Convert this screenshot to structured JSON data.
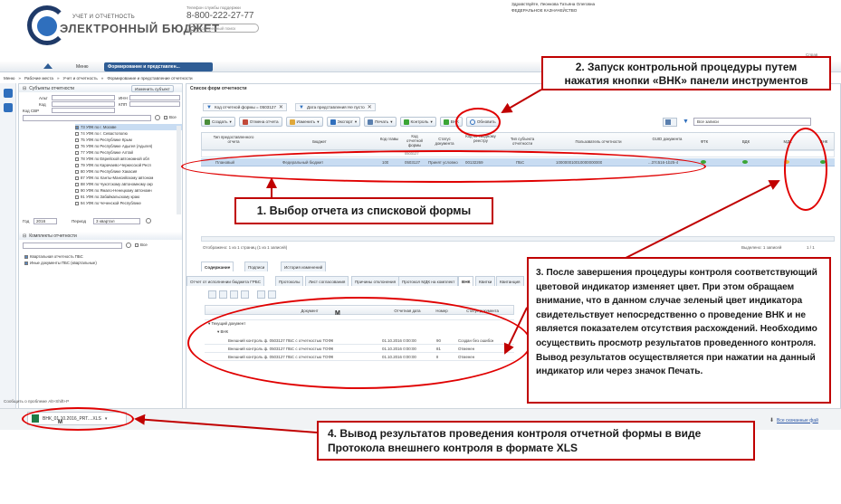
{
  "brand": {
    "line1": "УЧЕТ И ОТЧЕТНОСТЬ",
    "line2": "ЭЛЕКТРОННЫЙ БЮДЖЕТ"
  },
  "support": {
    "caption": "Телефон службы поддержки",
    "phone": "8-800-222-27-77"
  },
  "search": {
    "placeholder": "Расширенный поиск"
  },
  "user": {
    "greeting": "Здравствуйте, Леонкова Татьяна Олеговна",
    "org": "ФЕДЕРАЛЬНОЕ КАЗНАЧЕЙСТВО",
    "right_label": "Справ"
  },
  "nav": {
    "menu": "Меню",
    "active_tab": "Формирование и представлен..."
  },
  "breadcrumb": [
    "Меню",
    "Рабочие места",
    "Учет и отчетность",
    "Формирование и представление отчетности"
  ],
  "left": {
    "subjects_title": "Субъекты отчетности",
    "change_subject": "Изменить субъект",
    "alt_label": "Альт",
    "inn_label": "ИНН",
    "code_label": "Код",
    "kpp_label": "КПП",
    "svr_label": "Код СВР",
    "all_label": "Все",
    "tree": [
      "73 УФК по г. Москве",
      "74 УФК по г. Севастополю",
      "75 УФК по Республике Крым",
      "76 УФК по Республике Адыгея (Адыгея)",
      "77 УФК по Республике Алтай",
      "78 УФК по Еврейской автономной обл",
      "79 УФК по Карачаево-Черкесской Респ",
      "80 УФК по Республике Хакасия",
      "87 УФК по Ханты-Мансийскому автоном",
      "88 УФК по Чукотскому автономному окр",
      "90 УФК по Ямало-Ненецкому автономн",
      "91 УФК по Забайкальскому краю",
      "94 УФК по Чеченской Республике"
    ],
    "year_label": "Год",
    "year": "2016",
    "period_label": "Период",
    "period": "3 квартал",
    "sets_title": "Комплекты отчетности",
    "sets_all": "Все",
    "sets": [
      "Квартальная отчетность ПБС",
      "Иные документы ПБС (квартальные)"
    ]
  },
  "main": {
    "title": "Список форм отчетности",
    "filters": [
      "Код отчетной формы = 0503127",
      "Дата представления Не пусто"
    ],
    "toolbar": [
      "Создать",
      "Отмена отчета",
      "Изменить",
      "Экспорт",
      "Печать",
      "Контроль",
      "ВНК",
      "Обновить"
    ],
    "search_placeholder": "Все записи",
    "columns": [
      "Тип предоставленного отчета",
      "Бюджет",
      "Код главы",
      "Код отчетной формы",
      "Статус документа",
      "Код по сводному реестру",
      "Тип субъекта отчетности",
      "Пользователь отчетности",
      "GUID документа",
      "ФТК",
      "ВДК",
      "МДК",
      "ВНК"
    ],
    "filter_value": "0503127",
    "row": [
      "Плановый",
      "Федеральный бюджет",
      "100",
      "0503127",
      "Принят условно",
      "00132269",
      "ПБС",
      "100000010010000000000",
      "...37c516-1b25-4"
    ],
    "statusbar": "Отображено: 1 из 1 страниц (1 из 1 записей)",
    "selected": "Выделено: 1 записей",
    "page_info": "1 / 1"
  },
  "bottom": {
    "tabs": [
      "Содержание",
      "Подписи",
      "История изменений"
    ],
    "subtabs": [
      "Отчет от исполнении бюджета ГРБС",
      "Протоколы",
      "Лист согласования",
      "Причины отклонения",
      "Протокол МДК на комплект",
      "ВНК",
      "Квитки",
      "Квитанция"
    ],
    "columns": [
      "Документ",
      "Отчетная дата",
      "Номер",
      "Статус документа"
    ],
    "cursor_label": "M",
    "group1": "Текущий документ",
    "group2": "ВНК",
    "rows": [
      [
        "Внешний контроль ф. 0503127 ПБС с отчетностью ТОФК",
        "01.10.2016 0:00:00",
        "90",
        "Создан без ошибок"
      ],
      [
        "Внешний контроль ф. 0503127 ПБС с отчетностью ТОФК",
        "01.10.2016 0:00:00",
        "81",
        "Отменен"
      ],
      [
        "Внешний контроль ф. 0503127 ПБС с отчетностью ТОФК",
        "01.10.2016 0:00:00",
        "8",
        "Отменен"
      ]
    ]
  },
  "footer": {
    "report_problem": "Сообщить о проблеме Alt+Shift+P",
    "download_file": "ВНК_01.10.2016_PRT....XLS",
    "download_label": "M",
    "all_downloads": "Все скачанные фай"
  },
  "callouts": {
    "c1": "1. Выбор отчета из списковой формы",
    "c2": "2. Запуск контрольной процедуры путем нажатия кнопки «ВНК» панели инструментов",
    "c3": "3. После завершения процедуры контроля соответствующий цветовой индикатор изменяет цвет. При этом обращаем внимание, что в данном случае зеленый цвет индикатора свидетельствует непосредственно о проведение ВНК и не является показателем отсутствия расхождений. Необходимо осуществить просмотр результатов проведенного контроля. Вывод результатов осуществляется при нажатии на данный индикатор или через значок Печать.",
    "c4": "4. Вывод результатов проведения контроля отчетной формы в виде Протокола внешнего контроля в формате XLS"
  },
  "colors": {
    "red": "#c00000",
    "navy": "#1f3a68",
    "green": "#3aa535",
    "yellow": "#e8b93c",
    "select_blue": "#c8dcf2"
  }
}
